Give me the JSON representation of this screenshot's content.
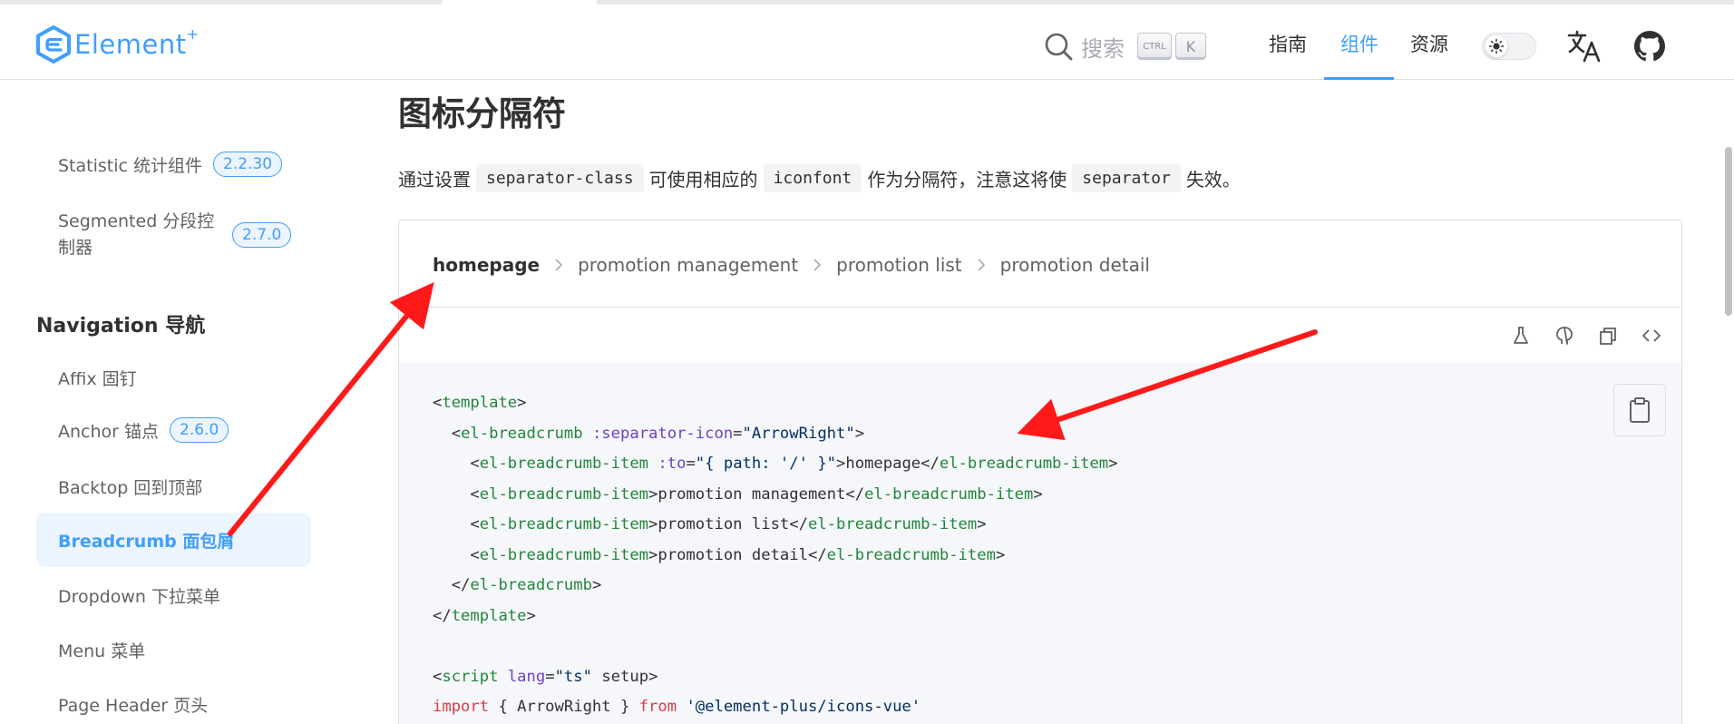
{
  "header": {
    "logo_text": "Element",
    "logo_plus": "+",
    "search_label": "搜索",
    "kbd_ctrl": "CTRL",
    "kbd_k": "K",
    "nav": [
      "指南",
      "组件",
      "资源"
    ],
    "active_nav": "组件",
    "accent_color": "#409eff"
  },
  "sidebar": {
    "items": [
      {
        "label": "Statistic 统计组件",
        "badge": "2.2.30"
      },
      {
        "label": "Segmented 分段控制器",
        "badge": "2.7.0"
      }
    ],
    "section_title": "Navigation 导航",
    "nav_items": [
      {
        "label": "Affix 固钉",
        "badge": ""
      },
      {
        "label": "Anchor 锚点",
        "badge": "2.6.0"
      },
      {
        "label": "Backtop 回到顶部",
        "badge": ""
      },
      {
        "label": "Breadcrumb 面包屑",
        "badge": ""
      },
      {
        "label": "Dropdown 下拉菜单",
        "badge": ""
      },
      {
        "label": "Menu 菜单",
        "badge": ""
      },
      {
        "label": "Page Header 页头",
        "badge": ""
      }
    ],
    "active_item": "Breadcrumb 面包屑"
  },
  "main": {
    "title": "图标分隔符",
    "desc_1": "通过设置",
    "desc_code_1": "separator-class",
    "desc_2": "可使用相应的",
    "desc_code_2": "iconfont",
    "desc_3": "作为分隔符，注意这将使",
    "desc_code_3": "separator",
    "desc_4": "失效。"
  },
  "demo": {
    "breadcrumb": [
      "homepage",
      "promotion management",
      "promotion list",
      "promotion detail"
    ],
    "op_icons": [
      "playground-icon",
      "github-icon",
      "copy-icon",
      "code-icon"
    ],
    "code_lines": [
      "<template>",
      "  <el-breadcrumb :separator-icon=\"ArrowRight\">",
      "    <el-breadcrumb-item :to=\"{ path: '/' }\">homepage</el-breadcrumb-item>",
      "    <el-breadcrumb-item>promotion management</el-breadcrumb-item>",
      "    <el-breadcrumb-item>promotion list</el-breadcrumb-item>",
      "    <el-breadcrumb-item>promotion detail</el-breadcrumb-item>",
      "  </el-breadcrumb>",
      "</template>",
      "",
      "<script lang=\"ts\" setup>",
      "import { ArrowRight } from '@element-plus/icons-vue'"
    ]
  },
  "annotation": {
    "arrow_color": "#ff1a1a"
  }
}
